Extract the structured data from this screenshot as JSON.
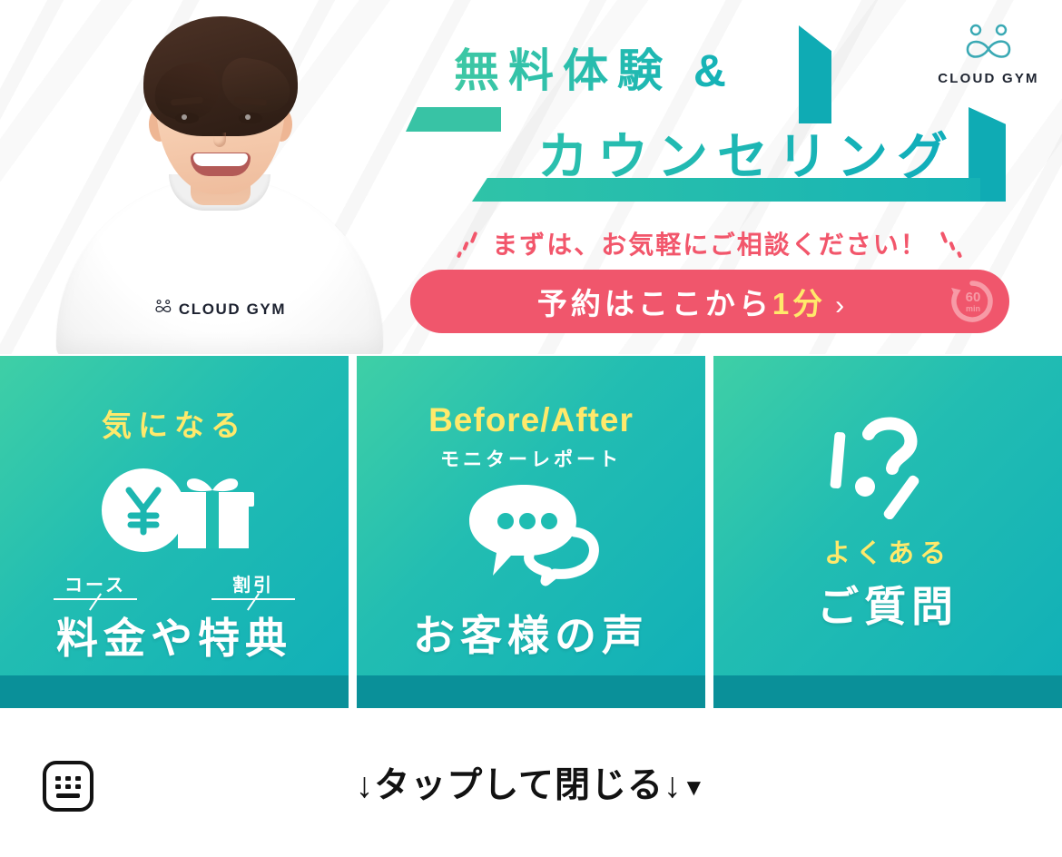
{
  "brand": {
    "name": "CLOUD GYM",
    "shirt_name": "CLOUD GYM",
    "logo_icon": "infinity-logo-icon",
    "accent_teal": "#10afb8",
    "accent_green": "#3fcfa6",
    "accent_pink": "#f0566c",
    "accent_yellow": "#ffe96b"
  },
  "hero": {
    "headline_line1": "無料体験 &",
    "headline_line2": "カウンセリング",
    "cta_caption": "まずは、お気軽にご相談ください！",
    "cta": {
      "label_prefix": "予約はここから",
      "label_highlight": "1分",
      "chevron": "›",
      "badge_value": "60",
      "badge_unit": "min",
      "badge_icon": "timer-arrow-icon"
    }
  },
  "cards": [
    {
      "id": "pricing",
      "top_label": "気になる",
      "icon": "yen-coin-gift-icon",
      "ruby": [
        {
          "text": "コース"
        },
        {
          "text": "割引"
        }
      ],
      "title": "料金や特典"
    },
    {
      "id": "voice",
      "top_label": "Before/After",
      "sub_label": "モニターレポート",
      "icon": "speech-bubble-icon",
      "title": "お客様の声"
    },
    {
      "id": "faq",
      "icon": "question-exclamation-icon",
      "top_label": "よくある",
      "title": "ご質問"
    }
  ],
  "footer": {
    "keyboard_icon": "keyboard-icon",
    "close_hint": "↓タップして閉じる↓",
    "close_triangle": "▼"
  }
}
